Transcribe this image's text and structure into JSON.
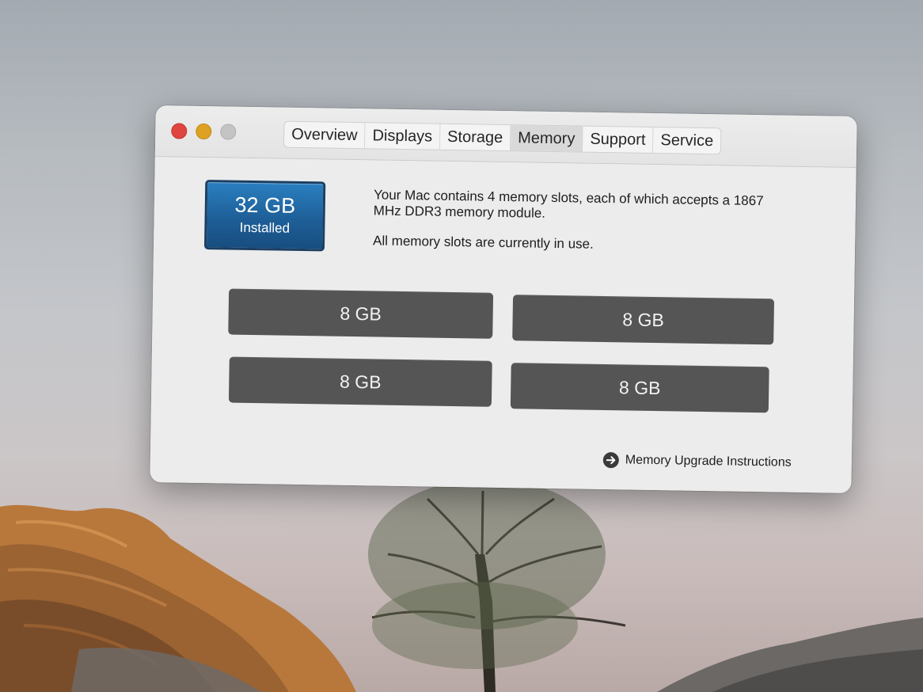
{
  "window": {
    "tabs": [
      {
        "label": "Overview",
        "active": false
      },
      {
        "label": "Displays",
        "active": false
      },
      {
        "label": "Storage",
        "active": false
      },
      {
        "label": "Memory",
        "active": true
      },
      {
        "label": "Support",
        "active": false
      },
      {
        "label": "Service",
        "active": false
      }
    ]
  },
  "memory": {
    "installed_size": "32 GB",
    "installed_label": "Installed",
    "description": "Your Mac contains 4 memory slots, each of which accepts a 1867 MHz DDR3 memory module.",
    "status": "All memory slots are currently in use.",
    "slots": [
      {
        "size": "8 GB"
      },
      {
        "size": "8 GB"
      },
      {
        "size": "8 GB"
      },
      {
        "size": "8 GB"
      }
    ],
    "upgrade_link": "Memory Upgrade Instructions"
  },
  "colors": {
    "badge_blue": "#1e5f98",
    "slot_gray": "#555555",
    "close": "#e0443e",
    "minimize": "#dea123",
    "zoom": "#c4c4c4"
  },
  "icons": {
    "upgrade_link": "arrow-circle-right-icon"
  }
}
